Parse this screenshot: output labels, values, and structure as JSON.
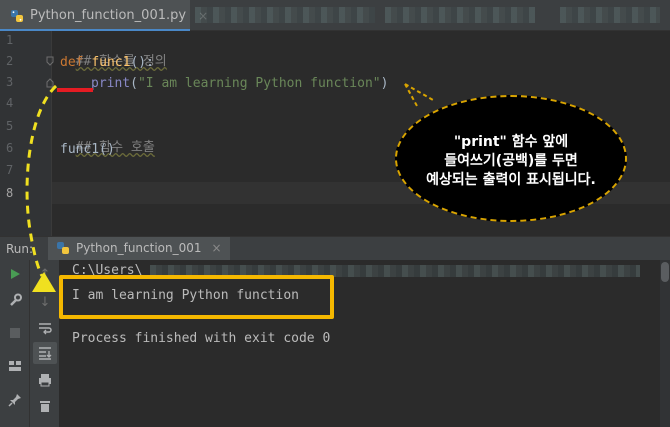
{
  "tab": {
    "filename": "Python_function_001.py",
    "close": "×"
  },
  "editor": {
    "line_numbers": [
      "1",
      "2",
      "3",
      "4",
      "5",
      "6",
      "7",
      "8"
    ],
    "comment1": "## 함수를 정의",
    "def_kw": "def ",
    "func_name": "func1",
    "def_tail": "():",
    "print_fn": "print",
    "paren_open": "(",
    "print_arg": "\"I am learning Python function\"",
    "paren_close": ")",
    "comment2": "## 함수 호출",
    "call": "func1()"
  },
  "run_panel": {
    "label": "Run:",
    "config_name": "Python_function_001",
    "close": "×"
  },
  "console": {
    "path_line": "C:\\Users\\",
    "output": "I am learning Python function",
    "exit_message": "Process finished with exit code 0"
  },
  "annotation": {
    "line1": "\"print\" 함수 앞에",
    "line2": "들여쓰기(공백)를 두면",
    "line3": "예상되는 출력이 표시됩니다."
  },
  "colors": {
    "highlight": "#f5b800",
    "red_mark": "#e51c23",
    "arrow": "#f0e020"
  }
}
